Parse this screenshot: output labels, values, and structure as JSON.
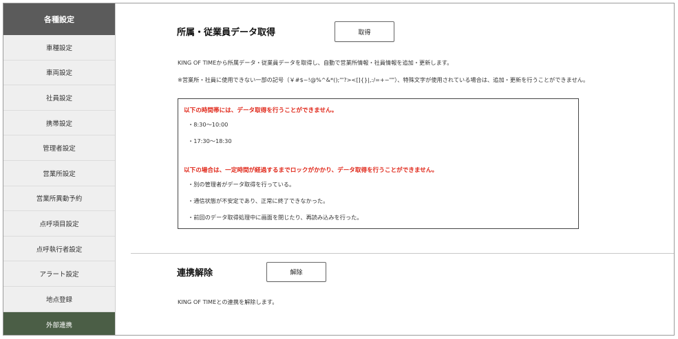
{
  "sidebar": {
    "header": "各種設定",
    "items": [
      {
        "label": "車種設定"
      },
      {
        "label": "車両設定"
      },
      {
        "label": "社員設定"
      },
      {
        "label": "携帯設定"
      },
      {
        "label": "管理者設定"
      },
      {
        "label": "営業所設定"
      },
      {
        "label": "営業所異動予約"
      },
      {
        "label": "点呼項目設定"
      },
      {
        "label": "点呼執行者設定"
      },
      {
        "label": "アラート設定"
      },
      {
        "label": "地点登録"
      },
      {
        "label": "外部連携"
      }
    ],
    "active_color": "#4b5e46"
  },
  "fetch_section": {
    "title": "所属・従業員データ取得",
    "button_label": "取得",
    "description": "KING OF TIMEから所属データ・従業員データを取得し、自動で営業所情報・社員情報を追加・更新します。",
    "warning": "※営業所・社員に使用できない一部の記号（￥#$~!@%^&*();'\"?><[]{}|,:/=+−\"\"）、特殊文字が使用されている場合は、追加・更新を行うことができません。",
    "notice": {
      "time_heading": "以下の時間帯には、データ取得を行うことができません。",
      "times": [
        "・8:30〜10:00",
        "・17:30〜18:30"
      ],
      "lock_heading": "以下の場合は、一定時間が経過するまでロックがかかり、データ取得を行うことができません。",
      "lock_reasons": [
        "・別の管理者がデータ取得を行っている。",
        "・通信状態が不安定であり、正常に終了できなかった。",
        "・前回のデータ取得処理中に画面を閉じたり、再読み込みを行った。"
      ],
      "accent_color": "#e0281a"
    }
  },
  "release_section": {
    "title": "連携解除",
    "button_label": "解除",
    "description": "KING OF TIMEとの連携を解除します。"
  }
}
